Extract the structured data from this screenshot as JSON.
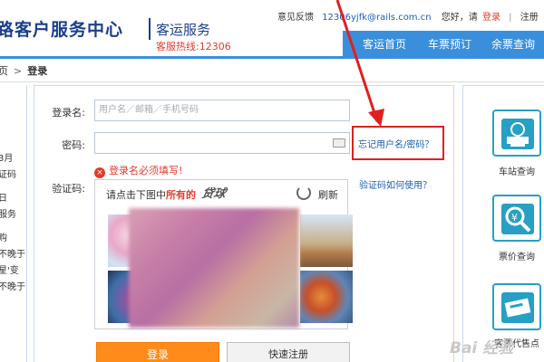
{
  "header": {
    "title": "铁路客户服务中心",
    "title_visible": "路客户服务中心",
    "subtitle": "客运服务",
    "hotline": "客服热线:12306",
    "feedback": "意见反馈",
    "feedback_email": "12306yjfk@rails.com.cn",
    "greeting": "您好，请",
    "login": "登录",
    "divider": "|",
    "register": "注册",
    "nav": [
      "客运首页",
      "车票预订",
      "余票查询"
    ]
  },
  "breadcrumb": {
    "home": "首页",
    "home_visible": "页",
    "separator": ">",
    "current": "登录"
  },
  "left_panel": {
    "lines": [
      "3月",
      "证码",
      "日",
      "服务",
      "购",
      "不晚于",
      "星'变",
      "不晚于"
    ]
  },
  "form": {
    "username_label": "登录名:",
    "username_placeholder": "用户名／邮箱／手机号码",
    "password_label": "密码:",
    "error_icon": "×",
    "error_text": "登录名必须填写!",
    "captcha_label": "验证码:",
    "forgot_link": "忘记用户名/密码？",
    "captcha_help": "验证码如何使用？",
    "captcha_prompt_prefix": "请点击下图中",
    "captcha_prompt_emphasis": "所有的",
    "captcha_word": "贷球",
    "refresh_label": "刷新",
    "login_button": "登录",
    "register_button": "快速注册"
  },
  "services": [
    {
      "label": "车站查询",
      "icon": "station-icon"
    },
    {
      "label": "票价查询",
      "icon": "price-search-icon"
    },
    {
      "label": "客票代售点",
      "icon": "ticket-agent-icon"
    }
  ],
  "watermark": "Bai 经验",
  "colors": {
    "brand_blue": "#1b3f8c",
    "nav_blue": "#3a8fdc",
    "alert_red": "#e03b2c",
    "login_orange": "#ff8b1a",
    "service_teal": "#26a0c4"
  }
}
